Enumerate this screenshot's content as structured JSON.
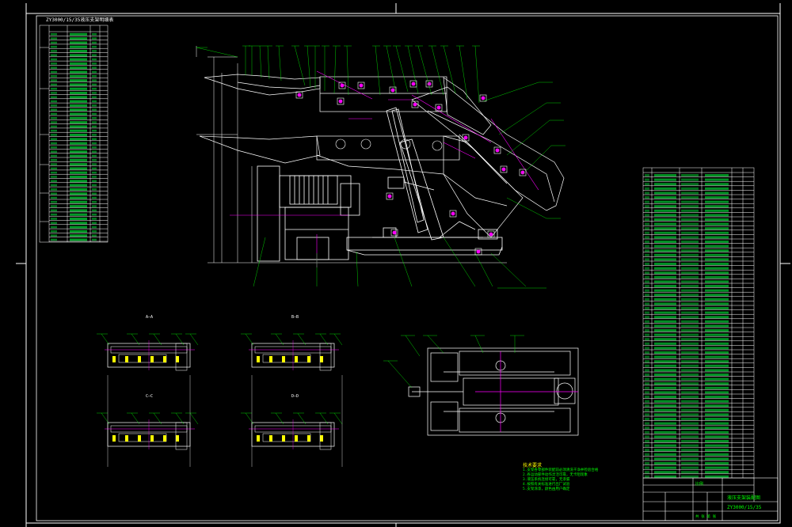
{
  "bom_left_header": "ZY3000/15/35液压支架明细表",
  "section_labels": [
    "A—A",
    "B—B",
    "C—C",
    "D—D"
  ],
  "notes_title": "技术要求",
  "notes_lines": [
    "1.支架各零部件装配前必须清洗干净并检验合格",
    "2.各运动部件动作灵活可靠，无卡阻现象",
    "3.液压系统连接可靠，无渗漏",
    "4.按照有关标准进行出厂试验",
    "5.支架涂漆，颜色由用户确定"
  ],
  "title_block": {
    "drawing_name": "液压支架装配图",
    "drawing_code": "ZY3000/15/35",
    "scale_label": "比例",
    "sheet_label": "共 张 第 张"
  },
  "colors": {
    "background": "#000000",
    "outline": "#ffffff",
    "leader": "#00ff00",
    "centerline": "#ff00ff",
    "annotation": "#ffff00"
  }
}
